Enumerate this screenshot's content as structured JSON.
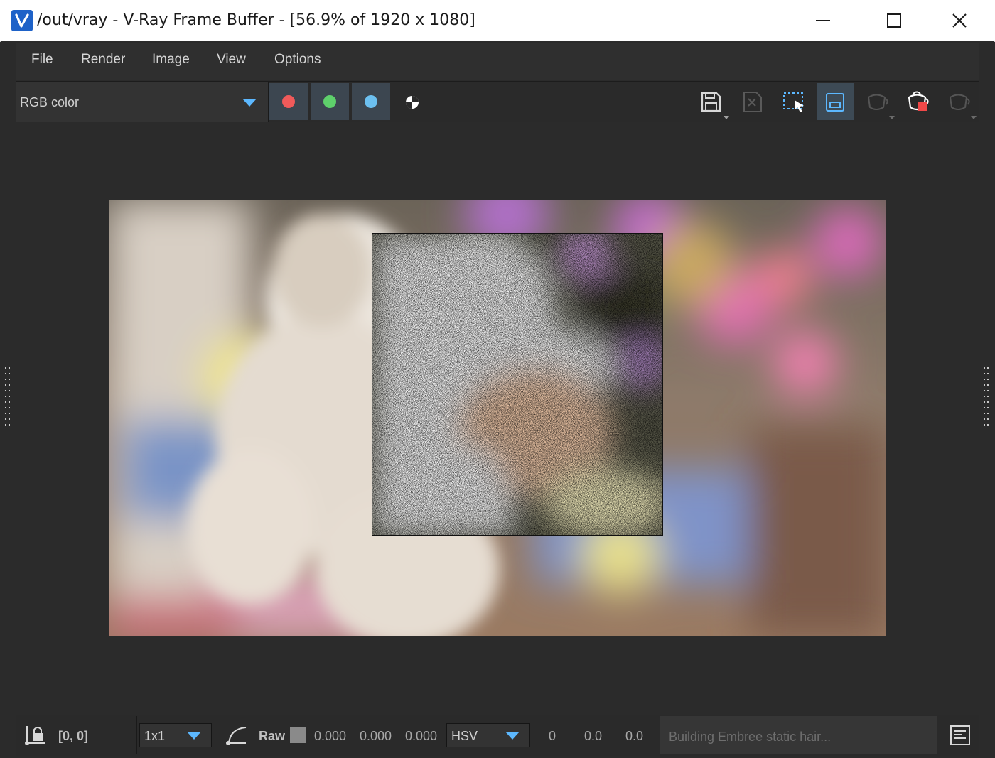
{
  "window": {
    "title": "/out/vray - V-Ray Frame Buffer - [56.9% of 1920 x 1080]",
    "logo_icon": "vray-logo-icon",
    "controls": [
      "minimize-icon",
      "maximize-icon",
      "close-icon"
    ]
  },
  "menu": {
    "items": [
      "File",
      "Render",
      "Image",
      "View",
      "Options"
    ]
  },
  "toolbar": {
    "channel_select": "RGB color",
    "channel_buttons": [
      {
        "name": "red-channel",
        "color": "#f05a5a"
      },
      {
        "name": "green-channel",
        "color": "#5ed06b"
      },
      {
        "name": "blue-channel",
        "color": "#6cc0f0"
      },
      {
        "name": "alpha-channel",
        "color": "#ffffff"
      }
    ],
    "tools": [
      "save-icon",
      "clear-image-icon",
      "region-render-icon",
      "track-mouse-icon",
      "render-last-icon",
      "render-stop-icon",
      "render-interactive-icon"
    ],
    "accent": "#5cb8ff"
  },
  "status": {
    "coords": "[0, 0]",
    "sample_size": "1x1",
    "mode_label": "Raw",
    "r": "0.000",
    "g": "0.000",
    "b": "0.000",
    "color_space": "HSV",
    "h": "0",
    "s": "0.0",
    "v": "0.0",
    "progress_text": "Building Embree static hair..."
  }
}
